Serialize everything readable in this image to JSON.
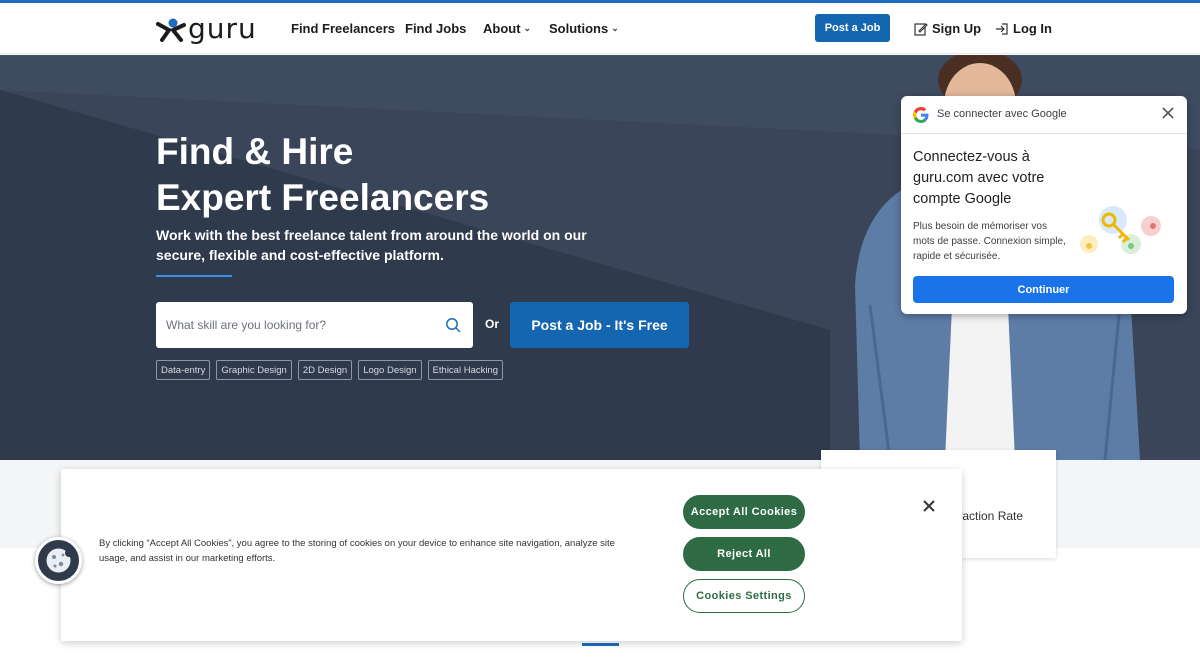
{
  "header": {
    "logo_text": "guru",
    "nav": [
      {
        "label": "Find Freelancers"
      },
      {
        "label": "Find Jobs"
      },
      {
        "label": "About"
      },
      {
        "label": "Solutions"
      }
    ],
    "post_job_label": "Post a Job",
    "signup_label": "Sign Up",
    "login_label": "Log In"
  },
  "hero": {
    "title_line1": "Find & Hire",
    "title_line2": "Expert Freelancers",
    "subtitle": "Work with the best freelance talent from around the world on our secure, flexible and cost-effective platform.",
    "search_placeholder": "What skill are you looking for?",
    "or_label": "Or",
    "post_job_free_label": "Post a Job - It's Free",
    "tags": [
      "Data-entry",
      "Graphic Design",
      "2D Design",
      "Logo Design",
      "Ethical Hacking"
    ]
  },
  "stats": {
    "partial_text": "faction Rate"
  },
  "google_popup": {
    "header": "Se connecter avec Google",
    "title": "Connectez-vous à guru.com avec votre compte Google",
    "body": "Plus besoin de mémoriser vos mots de passe. Connexion simple, rapide et sécurisée.",
    "button": "Continuer"
  },
  "cookie_banner": {
    "text": "By clicking “Accept All Cookies”, you agree to the storing of cookies on your device to enhance site navigation, analyze site usage, and assist in our marketing efforts.",
    "accept_label": "Accept All Cookies",
    "reject_label": "Reject All",
    "settings_label": "Cookies Settings"
  },
  "colors": {
    "brand_blue": "#1466b0",
    "hero_bg": "#3a4559",
    "cookie_green": "#2e6b45",
    "google_blue": "#1a73e8"
  }
}
